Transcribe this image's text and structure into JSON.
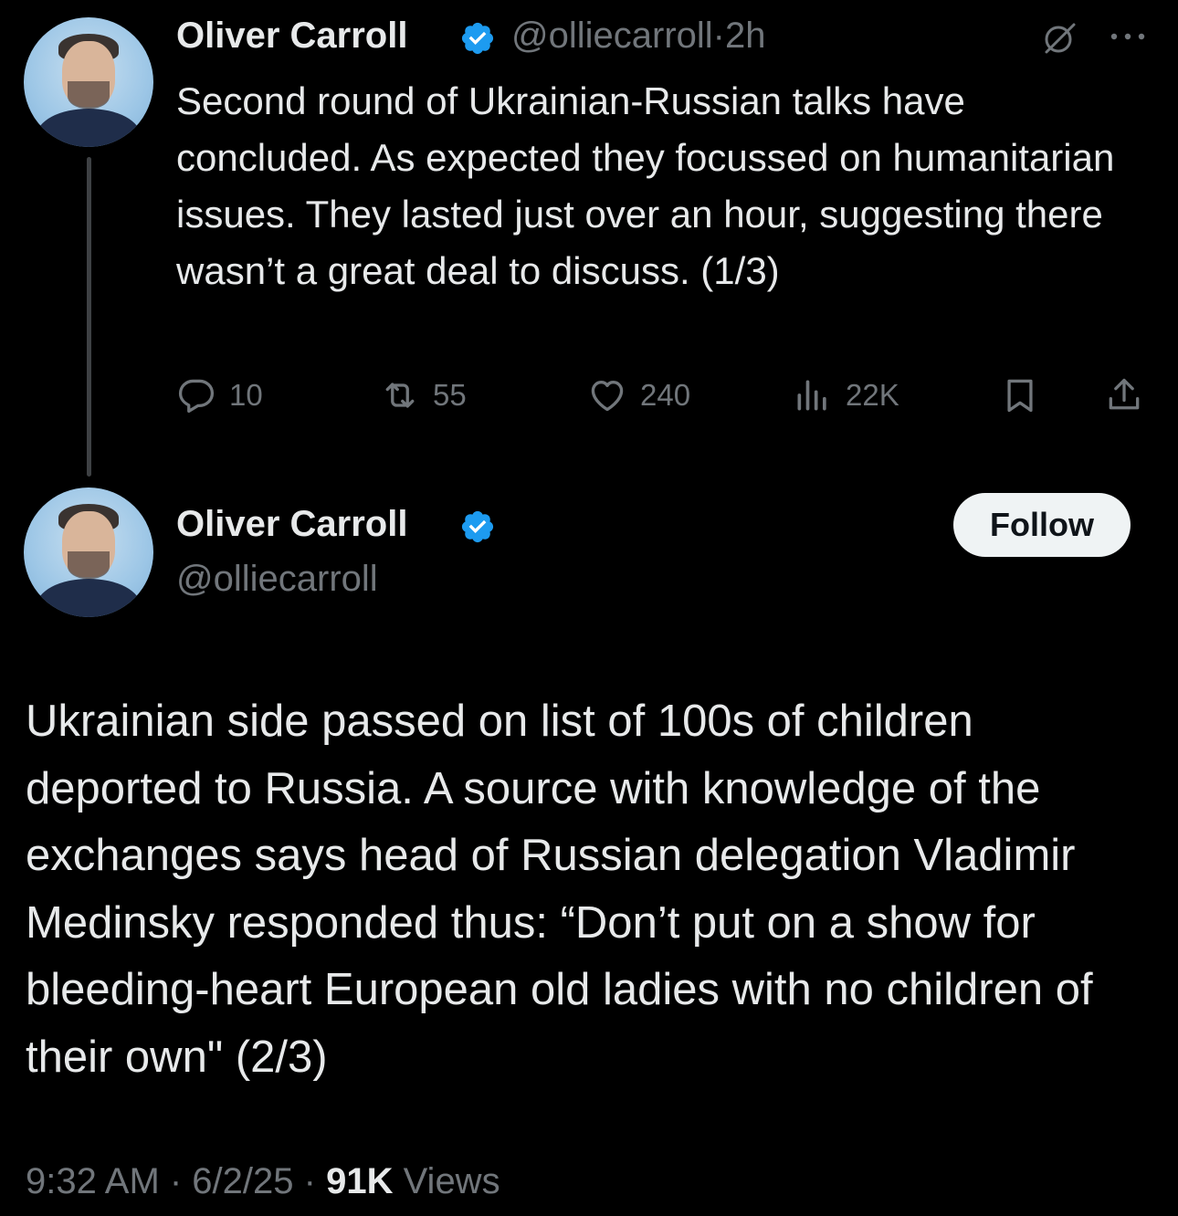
{
  "tweet1": {
    "name": "Oliver Carroll",
    "handle": "@olliecarroll",
    "separator": "·",
    "time": "2h",
    "text": "Second round of Ukrainian-Russian talks have concluded. As expected they focussed on humanitarian issues. They lasted just over an hour, suggesting there wasn’t a great deal to discuss. (1/3)",
    "replies": "10",
    "reposts": "55",
    "likes": "240",
    "views": "22K"
  },
  "tweet2": {
    "name": "Oliver Carroll",
    "handle": "@olliecarroll",
    "follow_label": "Follow",
    "text": "Ukrainian side passed on list of 100s of children deported to Russia. A source with knowledge of the exchanges says head of Russian delegation Vladimir Medinsky responded thus: “Don’t put on a show for bleeding-heart European old ladies with no children of their own\" (2/3)",
    "timestamp": "9:32 AM · 6/2/25 ·",
    "views_count": "91K",
    "views_label": "Views"
  },
  "icons": {
    "verified": "verified-badge-icon",
    "grok": "grok-icon",
    "more": "more-icon",
    "reply": "reply-icon",
    "repost": "repost-icon",
    "like": "heart-icon",
    "views": "views-icon",
    "bookmark": "bookmark-icon",
    "share": "share-icon"
  },
  "colors": {
    "background": "#000000",
    "text": "#e7e9ea",
    "muted": "#71767b",
    "verified": "#1d9bf0",
    "follow_bg": "#eff3f4"
  }
}
